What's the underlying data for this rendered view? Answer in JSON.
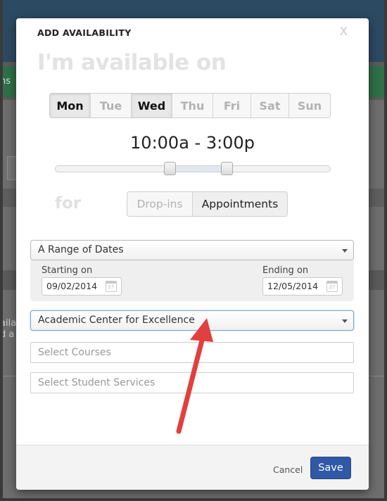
{
  "background": {
    "green_bar_text": "ns",
    "side_text_line1": "aila",
    "side_text_line2": "d a"
  },
  "modal": {
    "title": "ADD AVAILABILITY",
    "close_label": "X",
    "heading": "I'm available on",
    "days": [
      {
        "label": "Mon",
        "selected": true
      },
      {
        "label": "Tue",
        "selected": false
      },
      {
        "label": "Wed",
        "selected": true
      },
      {
        "label": "Thu",
        "selected": false
      },
      {
        "label": "Fri",
        "selected": false
      },
      {
        "label": "Sat",
        "selected": false
      },
      {
        "label": "Sun",
        "selected": false
      }
    ],
    "time_range": "10:00a - 3:00p",
    "for_label": "for",
    "type_options": {
      "dropins": "Drop-ins",
      "appointments": "Appointments",
      "selected": "Appointments"
    },
    "date_mode": {
      "selected": "A Range of Dates"
    },
    "start": {
      "label": "Starting on",
      "value": "09/02/2014"
    },
    "end": {
      "label": "Ending on",
      "value": "12/05/2014"
    },
    "location": {
      "selected": "Academic Center for Excellence"
    },
    "courses": {
      "placeholder": "Select Courses"
    },
    "services": {
      "placeholder": "Select Student Services"
    },
    "footer": {
      "cancel_label": "Cancel",
      "save_label": "Save"
    }
  },
  "colors": {
    "save_button": "#2f58a6",
    "annotation_arrow": "#e0403f",
    "header_blue": "#2c4a62",
    "nav_green": "#2f7047"
  },
  "icons": {
    "calendar": "calendar-icon",
    "dropdown": "chevron-down-icon",
    "annotation": "arrow-annotation"
  }
}
